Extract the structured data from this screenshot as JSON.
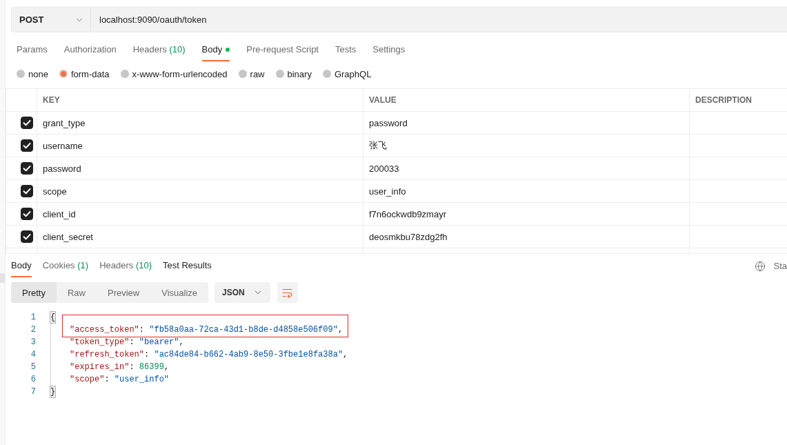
{
  "request": {
    "method": "POST",
    "url": "localhost:9090/oauth/token"
  },
  "request_tabs": [
    {
      "label": "Params",
      "selected": false,
      "modified": false
    },
    {
      "label": "Authorization",
      "selected": false,
      "modified": false
    },
    {
      "label": "Headers",
      "count": "(10)",
      "selected": false,
      "modified": false
    },
    {
      "label": "Body",
      "selected": true,
      "modified": true
    },
    {
      "label": "Pre-request Script",
      "selected": false,
      "modified": false
    },
    {
      "label": "Tests",
      "selected": false,
      "modified": false
    },
    {
      "label": "Settings",
      "selected": false,
      "modified": false
    }
  ],
  "body_types": [
    {
      "label": "none",
      "selected": false
    },
    {
      "label": "form-data",
      "selected": true
    },
    {
      "label": "x-www-form-urlencoded",
      "selected": false
    },
    {
      "label": "raw",
      "selected": false
    },
    {
      "label": "binary",
      "selected": false
    },
    {
      "label": "GraphQL",
      "selected": false
    }
  ],
  "form_table": {
    "columns": [
      "KEY",
      "VALUE",
      "DESCRIPTION"
    ],
    "rows": [
      {
        "checked": true,
        "key": "grant_type",
        "value": "password"
      },
      {
        "checked": true,
        "key": "username",
        "value": "张飞"
      },
      {
        "checked": true,
        "key": "password",
        "value": "200033"
      },
      {
        "checked": true,
        "key": "scope",
        "value": "user_info"
      },
      {
        "checked": true,
        "key": "client_id",
        "value": "f7n6ockwdb9zmayr"
      },
      {
        "checked": true,
        "key": "client_secret",
        "value": "deosmkbu78zdg2fh"
      }
    ]
  },
  "response": {
    "tabs": [
      {
        "label": "Body",
        "selected": true,
        "hovered": false
      },
      {
        "label": "Cookies",
        "count": "(1)",
        "selected": false,
        "hovered": false
      },
      {
        "label": "Headers",
        "count": "(10)",
        "selected": false,
        "hovered": false
      },
      {
        "label": "Test Results",
        "selected": false,
        "hovered": true
      }
    ],
    "status_text": "Sta",
    "views": [
      {
        "label": "Pretty",
        "selected": true
      },
      {
        "label": "Raw",
        "selected": false
      },
      {
        "label": "Preview",
        "selected": false
      },
      {
        "label": "Visualize",
        "selected": false
      }
    ],
    "format": "JSON",
    "code": {
      "lines": [
        {
          "number": "1",
          "highlighted": false,
          "bracket_match": true,
          "tokens": [
            {
              "kind": "punct",
              "text": "{"
            }
          ],
          "children": [
            {
              "number": "2",
              "highlighted": true,
              "bracket_match": false,
              "tokens": [
                {
                  "kind": "key",
                  "text": "\"access_token\""
                },
                {
                  "kind": "punct",
                  "text": ": "
                },
                {
                  "kind": "string",
                  "text": "\"fb58a0aa-72ca-43d1-b8de-d4858e506f09\""
                },
                {
                  "kind": "punct",
                  "text": ","
                }
              ]
            },
            {
              "number": "3",
              "highlighted": false,
              "bracket_match": false,
              "tokens": [
                {
                  "kind": "key",
                  "text": "\"token_type\""
                },
                {
                  "kind": "punct",
                  "text": ": "
                },
                {
                  "kind": "string",
                  "text": "\"bearer\""
                },
                {
                  "kind": "punct",
                  "text": ","
                }
              ]
            },
            {
              "number": "4",
              "highlighted": false,
              "bracket_match": false,
              "tokens": [
                {
                  "kind": "key",
                  "text": "\"refresh_token\""
                },
                {
                  "kind": "punct",
                  "text": ": "
                },
                {
                  "kind": "string",
                  "text": "\"ac84de84-b662-4ab9-8e50-3fbe1e8fa38a\""
                },
                {
                  "kind": "punct",
                  "text": ","
                }
              ]
            },
            {
              "number": "5",
              "highlighted": false,
              "bracket_match": false,
              "tokens": [
                {
                  "kind": "key",
                  "text": "\"expires_in\""
                },
                {
                  "kind": "punct",
                  "text": ": "
                },
                {
                  "kind": "number",
                  "text": "86399"
                },
                {
                  "kind": "punct",
                  "text": ","
                }
              ]
            },
            {
              "number": "6",
              "highlighted": false,
              "bracket_match": false,
              "tokens": [
                {
                  "kind": "key",
                  "text": "\"scope\""
                },
                {
                  "kind": "punct",
                  "text": ": "
                },
                {
                  "kind": "string",
                  "text": "\"user_info\""
                }
              ]
            }
          ]
        },
        {
          "number": "7",
          "highlighted": false,
          "bracket_match": true,
          "tokens": [
            {
              "kind": "punct",
              "text": "}"
            }
          ]
        }
      ]
    }
  }
}
